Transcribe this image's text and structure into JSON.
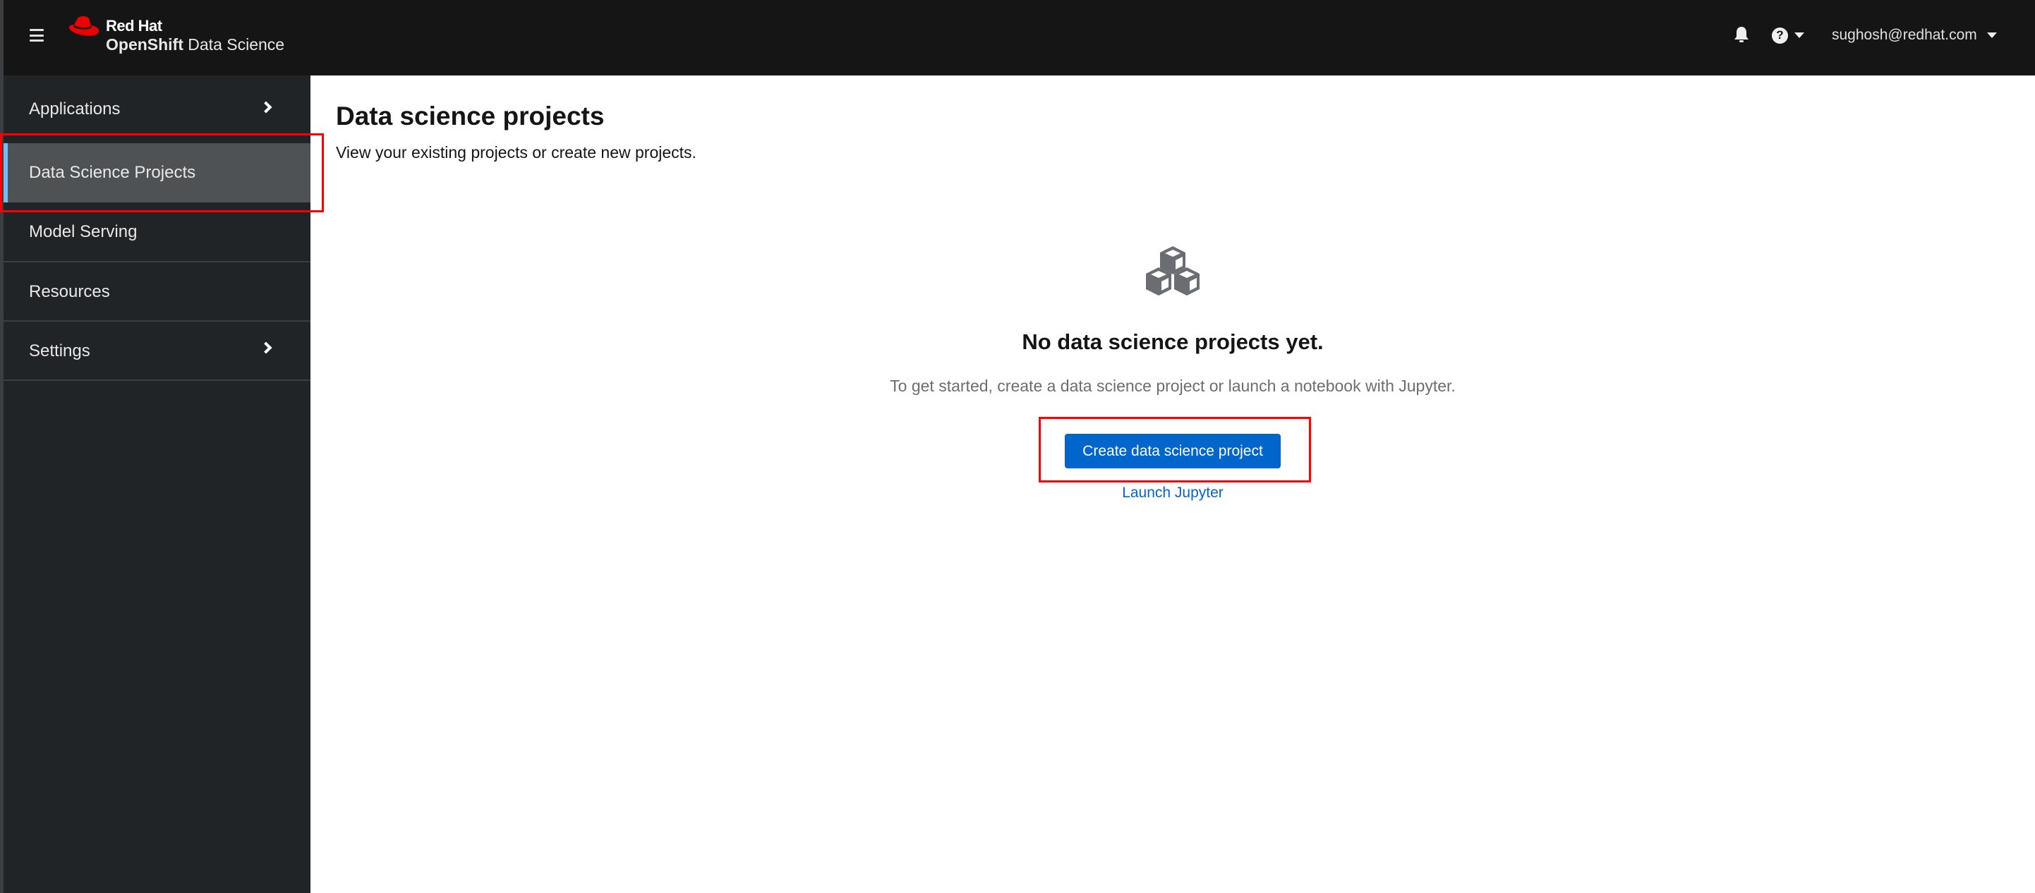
{
  "header": {
    "brand_top": "Red Hat",
    "brand_product_bold": "OpenShift",
    "brand_product_rest": " Data Science",
    "icons": {
      "menu": "hamburger-icon",
      "apps": "app-launcher-grid-icon",
      "notifications": "bell-icon",
      "help": "question-circle-icon",
      "help_caret": "caret-down-icon",
      "user_caret": "caret-down-icon"
    },
    "help_symbol": "?",
    "user": "sughosh@redhat.com"
  },
  "sidebar": {
    "items": [
      {
        "label": "Applications",
        "expandable": true,
        "active": false
      },
      {
        "label": "Data Science Projects",
        "expandable": false,
        "active": true
      },
      {
        "label": "Model Serving",
        "expandable": false,
        "active": false
      },
      {
        "label": "Resources",
        "expandable": false,
        "active": false
      },
      {
        "label": "Settings",
        "expandable": true,
        "active": false
      }
    ]
  },
  "main": {
    "title": "Data science projects",
    "description": "View your existing projects or create new projects.",
    "empty_state": {
      "icon": "cubes-icon",
      "title": "No data science projects yet.",
      "body": "To get started, create a data science project or launch a notebook with Jupyter.",
      "primary_action": "Create data science project",
      "secondary_action": "Launch Jupyter"
    }
  },
  "colors": {
    "masthead_bg": "#151515",
    "sidebar_bg": "#212427",
    "active_item_bg": "#4f5255",
    "active_indicator": "#73bcf7",
    "primary": "#0066cc",
    "brand_red": "#ee0000",
    "annotation_red": "#ff0000"
  }
}
